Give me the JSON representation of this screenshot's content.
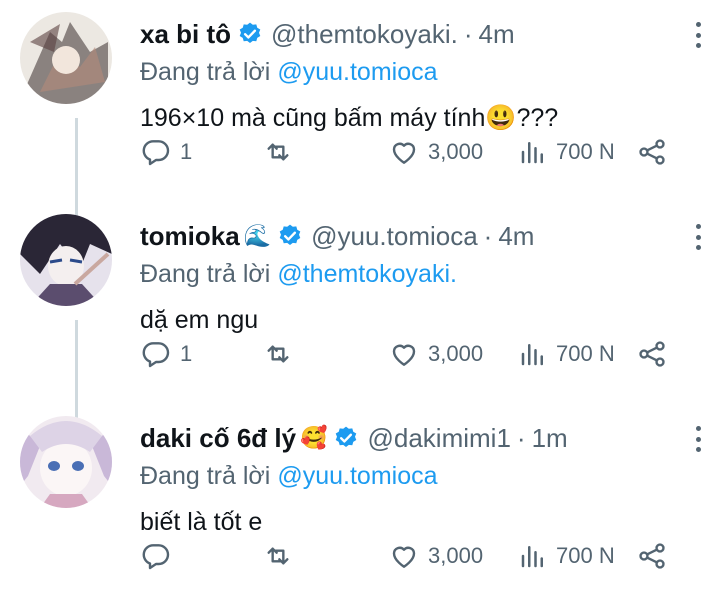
{
  "tweets": [
    {
      "name": "xa bi tô",
      "name_emoji": "",
      "handle": "@themtokoyaki.",
      "separator": "·",
      "time": "4m",
      "reply_prefix": "Đang trả lời",
      "reply_handle": "@yuu.tomioca",
      "text": "196×10 mà cũng bấm máy tính😃???",
      "replies": "1",
      "retweets": "",
      "likes": "3,000",
      "views": "700 N",
      "avatar_colors": [
        "#e9e4de",
        "#3a2e2e",
        "#b48a7a"
      ]
    },
    {
      "name": "tomioka",
      "name_emoji": "🌊",
      "handle": "@yuu.tomioca",
      "separator": "·",
      "time": "4m",
      "reply_prefix": "Đang trả lời",
      "reply_handle": "@themtokoyaki.",
      "text": "dặ em ngu",
      "replies": "1",
      "retweets": "",
      "likes": "3,000",
      "views": "700 N",
      "avatar_colors": [
        "#e6e2ec",
        "#2a2636",
        "#5b4d6e"
      ]
    },
    {
      "name": "daki cố 6đ lý",
      "name_emoji": "🥰",
      "handle": "@dakimimi1",
      "separator": "·",
      "time": "1m",
      "reply_prefix": "Đang trả lời",
      "reply_handle": "@yuu.tomioca",
      "text": "biết là tốt e",
      "replies": "",
      "retweets": "",
      "likes": "3,000",
      "views": "700 N",
      "avatar_colors": [
        "#f1eaf0",
        "#c9b8d8",
        "#4a6fb5"
      ]
    }
  ],
  "colors": {
    "text": "#0f1419",
    "secondary": "#536471",
    "link": "#1d9bf0",
    "verified": "#1d9bf0",
    "thread_line": "#cfd9de"
  },
  "icons": {
    "reply": "reply-icon",
    "retweet": "retweet-icon",
    "like": "heart-icon",
    "views": "views-icon",
    "share": "share-icon",
    "more": "more-icon",
    "verified": "verified-badge-icon"
  }
}
